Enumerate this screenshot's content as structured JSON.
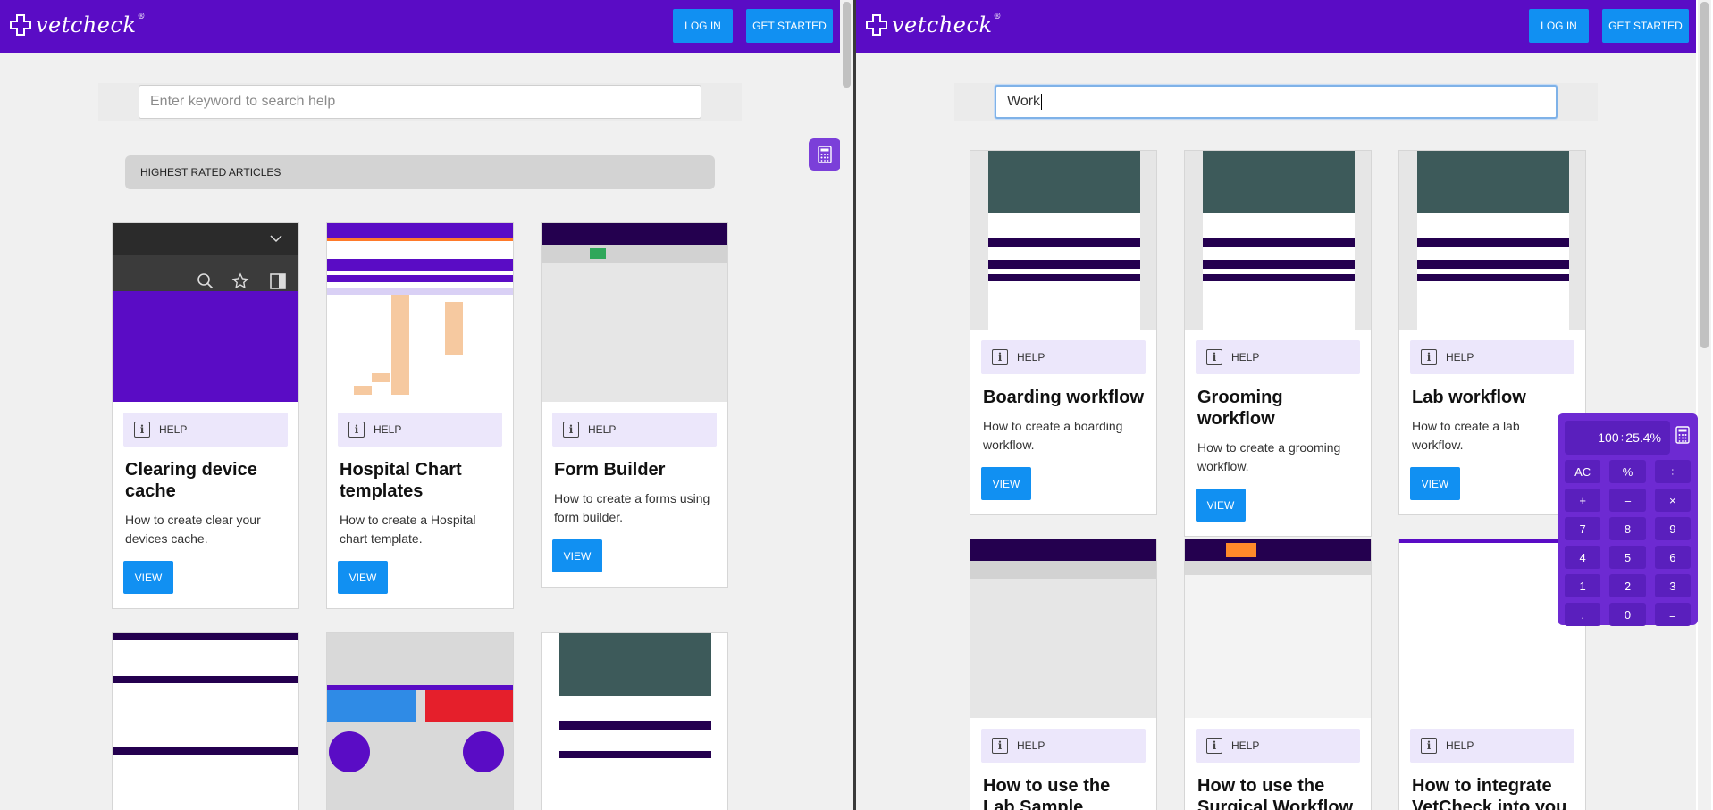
{
  "brand": {
    "name": "vetcheck",
    "reg": "®"
  },
  "nav": {
    "login": "LOG IN",
    "get_started": "GET STARTED"
  },
  "left": {
    "search_placeholder": "Enter keyword to search help",
    "section_title": "HIGHEST RATED ARTICLES",
    "cards": [
      {
        "badge": "HELP",
        "title": "Clearing device cache",
        "desc": "How to create clear your devices cache.",
        "view": "VIEW"
      },
      {
        "badge": "HELP",
        "title": "Hospital Chart templates",
        "desc": "How to create a Hospital chart template.",
        "view": "VIEW"
      },
      {
        "badge": "HELP",
        "title": "Form Builder",
        "desc": "How to create a forms using form builder.",
        "view": "VIEW"
      }
    ]
  },
  "right": {
    "search_value": "Work",
    "cards": [
      {
        "badge": "HELP",
        "title": "Boarding workflow",
        "desc": "How to create a boarding workflow.",
        "view": "VIEW"
      },
      {
        "badge": "HELP",
        "title": "Grooming workflow",
        "desc": "How to create a grooming workflow.",
        "view": "VIEW"
      },
      {
        "badge": "HELP",
        "title": "Lab workflow",
        "desc": "How to create a lab workflow.",
        "view": "VIEW"
      },
      {
        "badge": "HELP",
        "title": "How to use the Lab Sample Workflow"
      },
      {
        "badge": "HELP",
        "title": "How to use the Surgical Workflow"
      },
      {
        "badge": "HELP",
        "title": "How to integrate VetCheck into you"
      }
    ]
  },
  "calculator": {
    "display": "100÷25.4%",
    "keys": [
      "AC",
      "%",
      "÷",
      "+",
      "–",
      "×",
      "7",
      "8",
      "9",
      "4",
      "5",
      "6",
      "1",
      "2",
      "3",
      ".",
      "0",
      "="
    ]
  },
  "colors": {
    "brand_purple": "#5a0cc5",
    "accent_blue": "#1190f2",
    "calc_purple": "#6d2ad2"
  }
}
